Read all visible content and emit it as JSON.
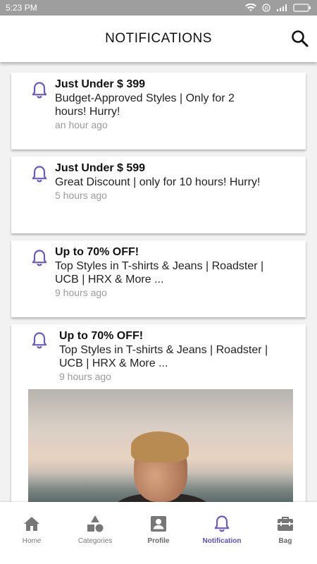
{
  "status_bar": {
    "time": "5:23 PM"
  },
  "header": {
    "title": "NOTIFICATIONS"
  },
  "notifications": [
    {
      "title": "Just Under $ 399",
      "body": "Budget-Approved Styles | Only for 2 hours! Hurry!",
      "time": "an hour ago"
    },
    {
      "title": "Just Under $ 599",
      "body": "Great Discount | only for 10 hours! Hurry!",
      "time": "5 hours ago"
    },
    {
      "title": "Up to 70% OFF!",
      "body": "Top Styles in T-shirts & Jeans | Roadster | UCB | HRX & More ...",
      "time": "9 hours ago"
    },
    {
      "title": "Up to 70% OFF!",
      "body": "Top Styles in T-shirts & Jeans | Roadster | UCB | HRX & More ...",
      "time": "9 hours ago"
    }
  ],
  "bottom_nav": {
    "tabs": [
      {
        "label": "Home",
        "icon": "home-icon"
      },
      {
        "label": "Categories",
        "icon": "categories-icon"
      },
      {
        "label": "Profile",
        "icon": "profile-icon"
      },
      {
        "label": "Notification",
        "icon": "bell-icon"
      },
      {
        "label": "Bag",
        "icon": "bag-icon"
      }
    ],
    "active": "Notification"
  },
  "colors": {
    "accent": "#5e4ec2",
    "bell": "#6a5ac8",
    "muted": "#9a9a9a",
    "status_bar": "#9e9e9e"
  }
}
